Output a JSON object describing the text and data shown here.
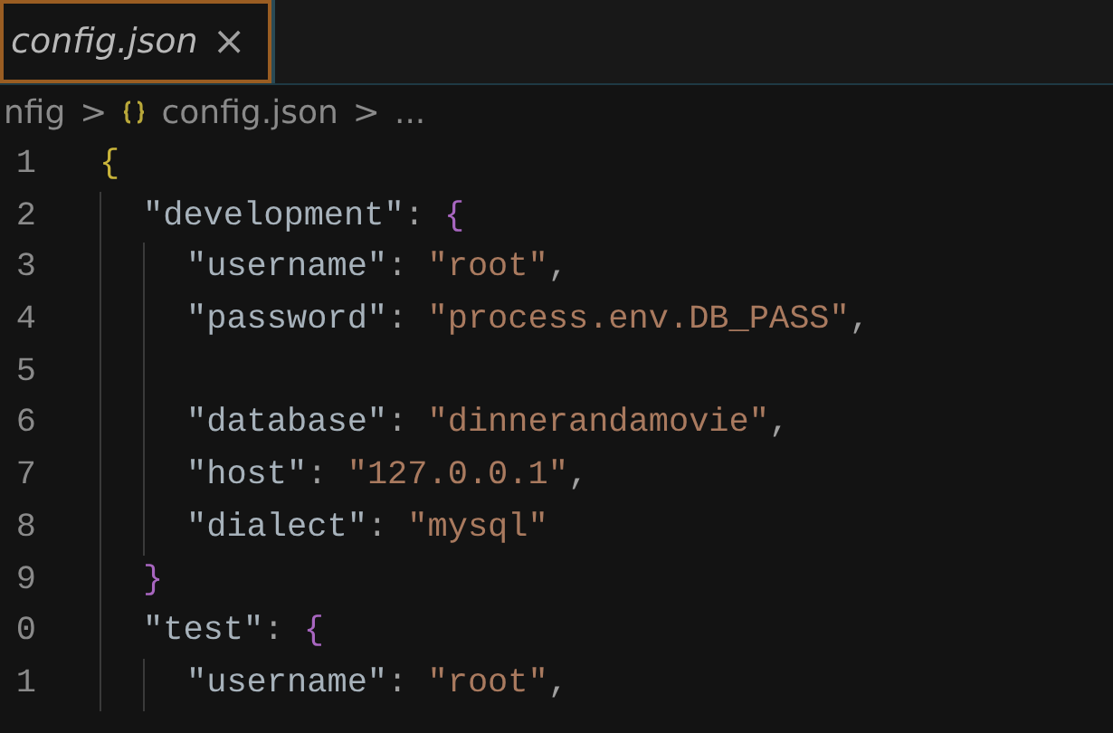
{
  "tabs": [
    {
      "label": "config.json",
      "selected": true,
      "close": "×"
    }
  ],
  "breadcrumb": {
    "folder": "nfig",
    "separator": ">",
    "file": "config.json",
    "rest": "..."
  },
  "lines": [
    {
      "number": "1",
      "tokens": [
        {
          "kind": "bracket",
          "text": "{",
          "color": "#c9b43a"
        }
      ],
      "children": [
        {
          "number": "2",
          "tokens": [
            {
              "kind": "key",
              "text": "\"development\""
            },
            {
              "kind": "punct",
              "text": ": "
            },
            {
              "kind": "bracket",
              "text": "{",
              "color": "#a866c0"
            }
          ],
          "children": [
            {
              "number": "3",
              "tokens": [
                {
                  "kind": "key",
                  "text": "\"username\""
                },
                {
                  "kind": "punct",
                  "text": ": "
                },
                {
                  "kind": "string",
                  "text": "\"root\""
                },
                {
                  "kind": "punct",
                  "text": ","
                }
              ]
            },
            {
              "number": "4",
              "tokens": [
                {
                  "kind": "key",
                  "text": "\"password\""
                },
                {
                  "kind": "punct",
                  "text": ": "
                },
                {
                  "kind": "string",
                  "text": "\"process.env.DB_PASS\""
                },
                {
                  "kind": "punct",
                  "text": ","
                }
              ]
            },
            {
              "number": "5"
            },
            {
              "number": "6",
              "tokens": [
                {
                  "kind": "key",
                  "text": "\"database\""
                },
                {
                  "kind": "punct",
                  "text": ": "
                },
                {
                  "kind": "string",
                  "text": "\"dinnerandamovie\""
                },
                {
                  "kind": "punct",
                  "text": ","
                }
              ]
            },
            {
              "number": "7",
              "tokens": [
                {
                  "kind": "key",
                  "text": "\"host\""
                },
                {
                  "kind": "punct",
                  "text": ": "
                },
                {
                  "kind": "string",
                  "text": "\"127.0.0.1\""
                },
                {
                  "kind": "punct",
                  "text": ","
                }
              ]
            },
            {
              "number": "8",
              "tokens": [
                {
                  "kind": "key",
                  "text": "\"dialect\""
                },
                {
                  "kind": "punct",
                  "text": ": "
                },
                {
                  "kind": "string",
                  "text": "\"mysql\""
                }
              ]
            }
          ]
        },
        {
          "number": "9",
          "tokens": [
            {
              "kind": "bracket",
              "text": "}",
              "color": "#a866c0"
            }
          ]
        },
        {
          "number": "0",
          "tokens": [
            {
              "kind": "key",
              "text": "\"test\""
            },
            {
              "kind": "punct",
              "text": ": "
            },
            {
              "kind": "bracket",
              "text": "{",
              "color": "#a866c0"
            }
          ],
          "children": [
            {
              "number": "1",
              "tokens": [
                {
                  "kind": "key",
                  "text": "\"username\""
                },
                {
                  "kind": "punct",
                  "text": ": "
                },
                {
                  "kind": "string",
                  "text": "\"root\""
                },
                {
                  "kind": "punct",
                  "text": ","
                }
              ]
            }
          ]
        }
      ]
    }
  ]
}
